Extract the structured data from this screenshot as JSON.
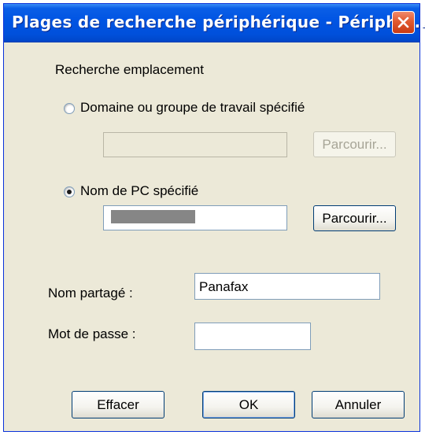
{
  "window": {
    "title": "Plages de recherche périphérique - Périphé..."
  },
  "search": {
    "group_label": "Recherche emplacement",
    "domain_option": {
      "label": "Domaine ou groupe de travail spécifié",
      "checked": false
    },
    "domain_value": "",
    "browse1_label": "Parcourir...",
    "pc_option": {
      "label": "Nom de PC spécifié",
      "checked": true
    },
    "browse2_label": "Parcourir..."
  },
  "share": {
    "label": "Nom partagé :",
    "value": "Panafax"
  },
  "password": {
    "label": "Mot de passe :",
    "value": ""
  },
  "buttons": {
    "clear": "Effacer",
    "ok": "OK",
    "cancel": "Annuler"
  },
  "icons": {
    "close": "close-icon",
    "radio": "radio-button"
  },
  "colors": {
    "title_bar": "#0054e3",
    "close": "#e15a30",
    "background": "#ece9d8"
  }
}
